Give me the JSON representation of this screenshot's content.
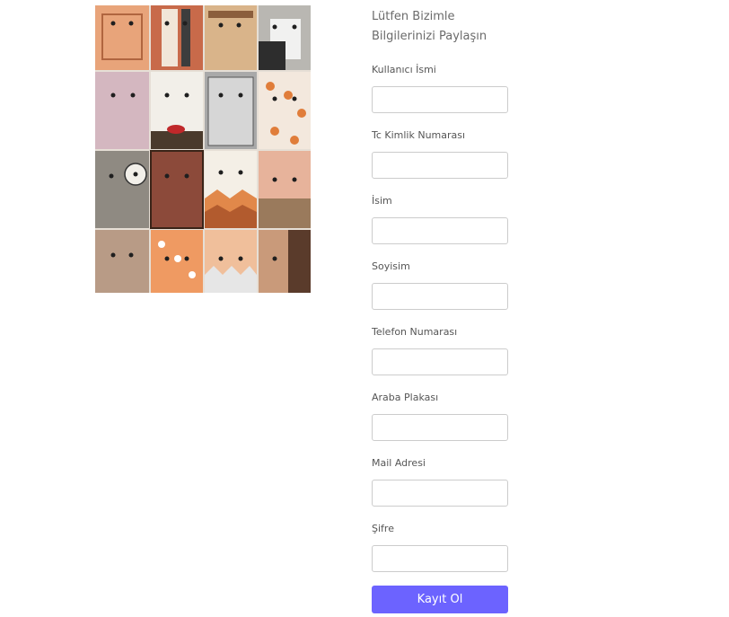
{
  "artwork": {
    "alt": "Seramik yüz panoları kolajı"
  },
  "intro": {
    "line1": "Lütfen Bizimle",
    "line2": "Bilgilerinizi Paylaşın"
  },
  "fields": [
    {
      "label": "Kullanıcı İsmi",
      "value": "",
      "placeholder": ""
    },
    {
      "label": "Tc Kimlik Numarası",
      "value": "",
      "placeholder": ""
    },
    {
      "label": "İsim",
      "value": "",
      "placeholder": ""
    },
    {
      "label": "Soyisim",
      "value": "",
      "placeholder": ""
    },
    {
      "label": "Telefon Numarası",
      "value": "",
      "placeholder": ""
    },
    {
      "label": "Araba Plakası",
      "value": "",
      "placeholder": ""
    },
    {
      "label": "Mail Adresi",
      "value": "",
      "placeholder": ""
    },
    {
      "label": "Şifre",
      "value": "",
      "placeholder": ""
    }
  ],
  "submit": {
    "label": "Kayıt Ol"
  },
  "colors": {
    "accent": "#6c63ff",
    "input_border": "#cccccc",
    "intro_text": "#6b6b6b",
    "label_text": "#555555"
  }
}
